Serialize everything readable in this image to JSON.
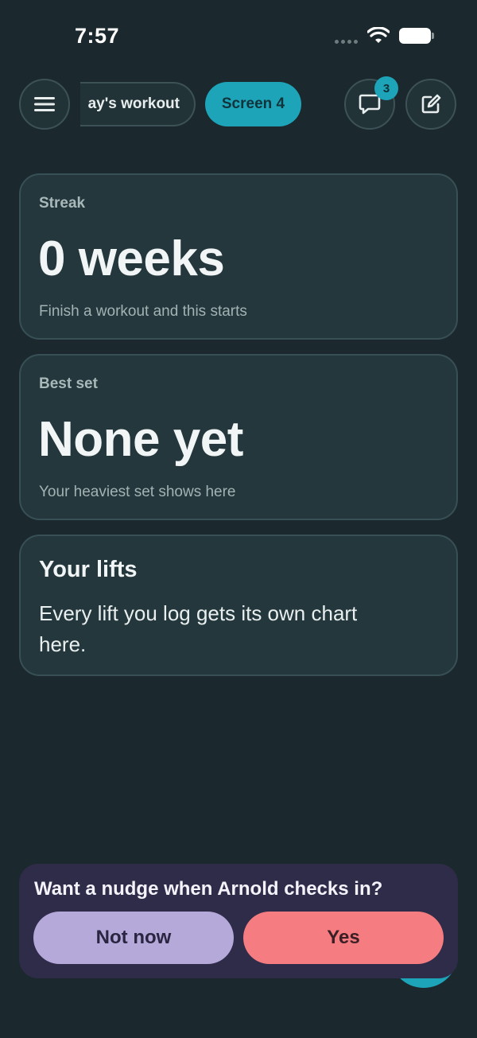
{
  "status_bar": {
    "time": "7:57",
    "icons": [
      "cellular-signal-icon",
      "wifi-icon",
      "battery-icon"
    ]
  },
  "nav": {
    "menu_icon": "hamburger-menu-icon",
    "tabs": [
      {
        "label": "ay's workout",
        "active": false
      },
      {
        "label": "Screen 4",
        "active": true
      }
    ],
    "chat_icon": "chat-bubble-icon",
    "chat_badge": "3",
    "edit_icon": "edit-square-icon"
  },
  "cards": {
    "streak": {
      "label": "Streak",
      "value": "0 weeks",
      "hint": "Finish a workout and this starts"
    },
    "best_set": {
      "label": "Best set",
      "value": "None yet",
      "hint": "Your heaviest set shows here"
    },
    "lifts": {
      "title": "Your lifts",
      "body": "Every lift you log gets its own chart here."
    }
  },
  "prompt": {
    "title": "Want a nudge when Arnold checks in?",
    "decline_label": "Not now",
    "accept_label": "Yes"
  },
  "colors": {
    "background": "#1b292e",
    "card": "#24373c",
    "accent": "#1ea4b9",
    "prompt_bg": "#2f2c49",
    "decline": "#b5a9da",
    "accept": "#f57c80"
  }
}
